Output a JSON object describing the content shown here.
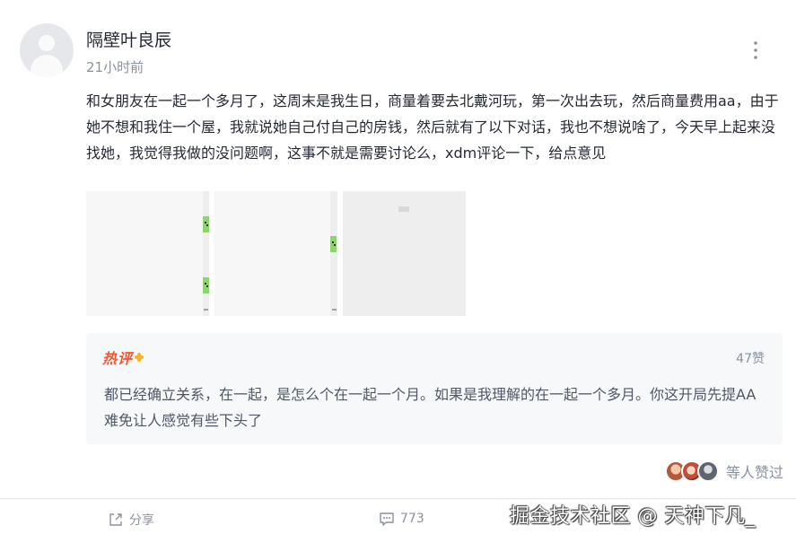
{
  "post": {
    "author": "隔壁叶良辰",
    "time": "21小时前",
    "content": "和女朋友在一起一个多月了，这周末是我生日，商量着要去北戴河玩，第一次出去玩，然后商量费用aa，由于她不想和我住一个屋，我就说她自己付自己的房钱，然后就有了以下对话，我也不想说啥了，今天早上起来没找她，我觉得我做的没问题啊，这事不就是需要讨论么，xdm评论一下，给点意见",
    "image_count": 3
  },
  "hot_comment": {
    "badge": "热评",
    "likes": "47赞",
    "text": "都已经确立关系，在一起，是怎么个在一起一个月。如果是我理解的在一起一个多月。你这开局先提AA难免让人感觉有些下头了"
  },
  "likers": {
    "label": "等人赞过"
  },
  "actions": {
    "share_label": "分享",
    "comment_count": "773"
  },
  "watermark": "掘金技术社区 @ 天神下凡_",
  "icons": {
    "more": "more-dots-icon",
    "share": "share-icon",
    "comment": "comment-icon"
  },
  "colors": {
    "text_primary": "#252933",
    "text_secondary": "#8a919f",
    "hot_badge": "#f5542d",
    "hot_box_bg": "#f7f8fa",
    "chat_green": "#8fd36f"
  }
}
